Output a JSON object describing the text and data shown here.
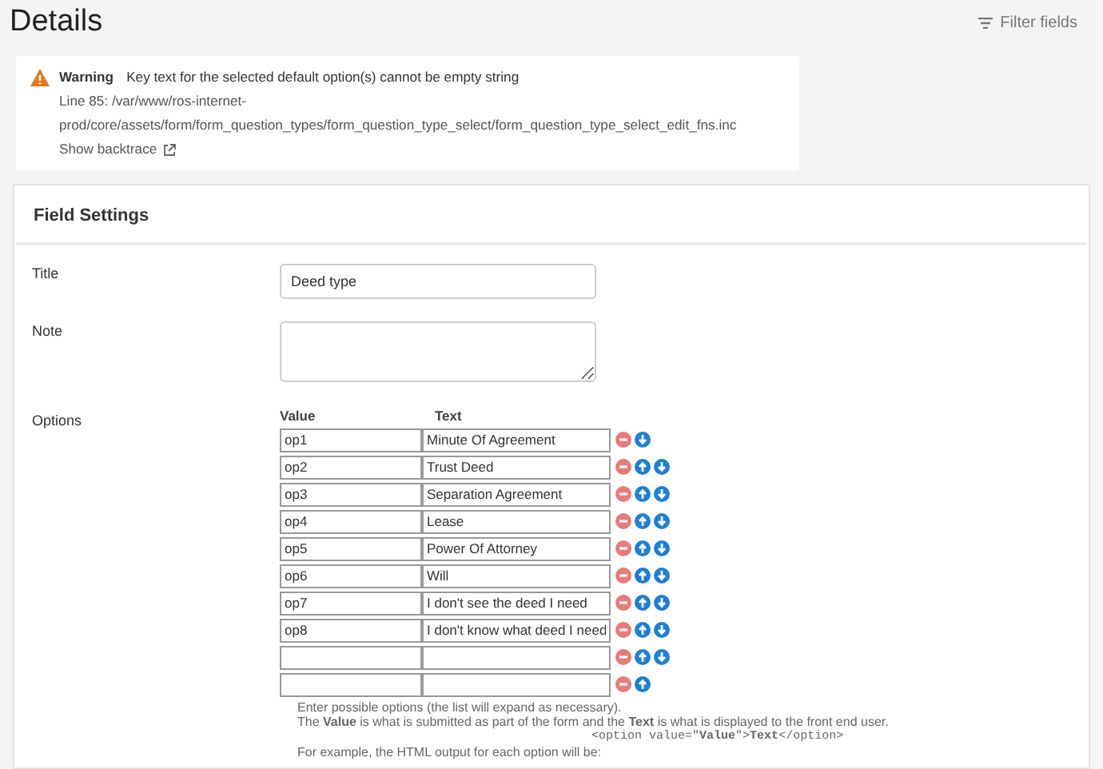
{
  "page": {
    "title": "Details",
    "filter_label": "Filter fields"
  },
  "warning": {
    "label": "Warning",
    "message": "Key text for the selected default option(s) cannot be empty string",
    "path_lines": [
      "Line 85: /var/www/ros-internet-",
      "prod/core/assets/form/form_question_types/form_question_type_select/form_question_type_select_edit_fns.inc"
    ],
    "backtrace_link": "Show backtrace"
  },
  "field_settings": {
    "heading": "Field Settings",
    "title_field": {
      "label": "Title",
      "value": "Deed type"
    },
    "note_field": {
      "label": "Note"
    },
    "options": {
      "label": "Options",
      "columns": [
        "Value",
        "Text"
      ],
      "rows": [
        {
          "value": "op1",
          "text": "Minute Of Agreement",
          "can_move_up": false,
          "can_move_down": true
        },
        {
          "value": "op2",
          "text": "Trust Deed",
          "can_move_up": true,
          "can_move_down": true
        },
        {
          "value": "op3",
          "text": "Separation Agreement",
          "can_move_up": true,
          "can_move_down": true
        },
        {
          "value": "op4",
          "text": "Lease",
          "can_move_up": true,
          "can_move_down": true
        },
        {
          "value": "op5",
          "text": "Power Of Attorney",
          "can_move_up": true,
          "can_move_down": true
        },
        {
          "value": "op6",
          "text": "Will",
          "can_move_up": true,
          "can_move_down": true
        },
        {
          "value": "op7",
          "text": "I don't see the deed I need",
          "can_move_up": true,
          "can_move_down": true
        },
        {
          "value": "op8",
          "text": "I don't know what deed I need",
          "can_move_up": true,
          "can_move_down": true
        },
        {
          "value": "",
          "text": "",
          "can_move_up": true,
          "can_move_down": true
        },
        {
          "value": "",
          "text": "",
          "can_move_up": true,
          "can_move_down": false
        }
      ],
      "help_lines": [
        "Enter possible options (the list will expand as necessary).",
        "The **Value** is what is submitted as part of the form and the **Text** is what is displayed to the front end user."
      ],
      "code_example": "<option value=\"**Value**\">**Text**</option>",
      "example_intro": "For example, the HTML output for each option will be:"
    }
  }
}
